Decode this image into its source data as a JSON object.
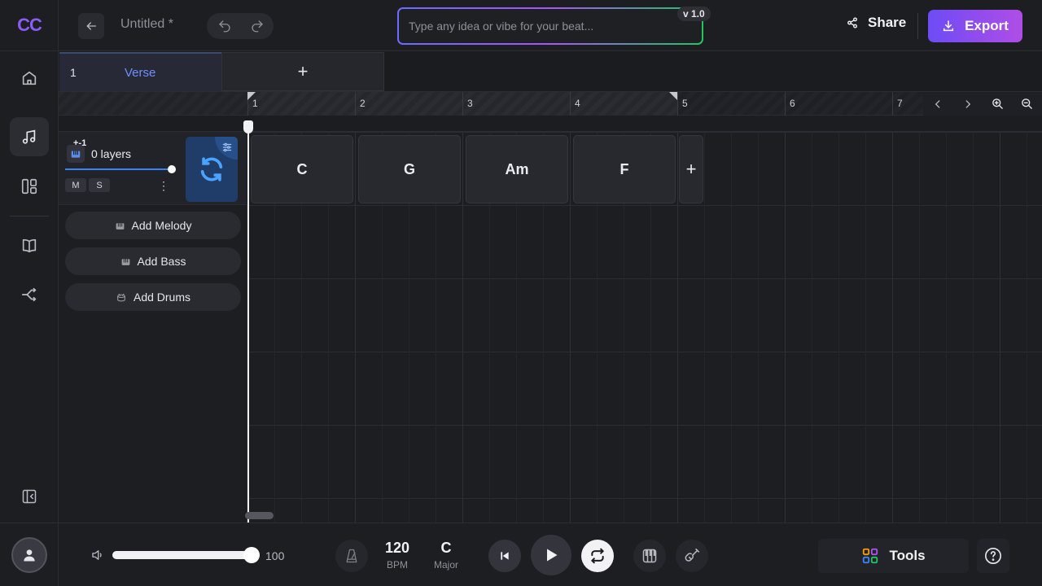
{
  "app": {
    "logo": "CC"
  },
  "header": {
    "doc_title": "Untitled *",
    "prompt_placeholder": "Type any idea or vibe for your beat...",
    "version": "v 1.0",
    "share_label": "Share",
    "export_label": "Export"
  },
  "sidebar": {
    "items": [
      {
        "name": "home-icon"
      },
      {
        "name": "music-note-icon",
        "active": true
      },
      {
        "name": "layout-icon"
      },
      {
        "name": "book-icon"
      },
      {
        "name": "shuffle-icon"
      },
      {
        "name": "collapse-panel-icon"
      }
    ]
  },
  "sections": [
    {
      "num": "1",
      "name": "Verse"
    }
  ],
  "add_section_label": "+",
  "ruler": {
    "bars": [
      "1",
      "2",
      "3",
      "4",
      "5",
      "6",
      "7"
    ]
  },
  "track": {
    "badge": "+-1",
    "layers_label": "0 layers",
    "mute": "M",
    "solo": "S",
    "volume": 1.0
  },
  "chords": [
    "C",
    "G",
    "Am",
    "F"
  ],
  "add_chord_label": "+",
  "add_buttons": {
    "melody": "Add Melody",
    "bass": "Add Bass",
    "drums": "Add Drums"
  },
  "transport": {
    "master_volume": "100",
    "master_volume_fraction": 1.0,
    "bpm": "120",
    "bpm_label": "BPM",
    "key": "C",
    "scale": "Major"
  },
  "tools_label": "Tools",
  "colors": {
    "accent": "#8b5cf6",
    "section_active": "#6f8fff",
    "export_gradient_start": "#6d4cf5",
    "export_gradient_end": "#b04de6"
  }
}
